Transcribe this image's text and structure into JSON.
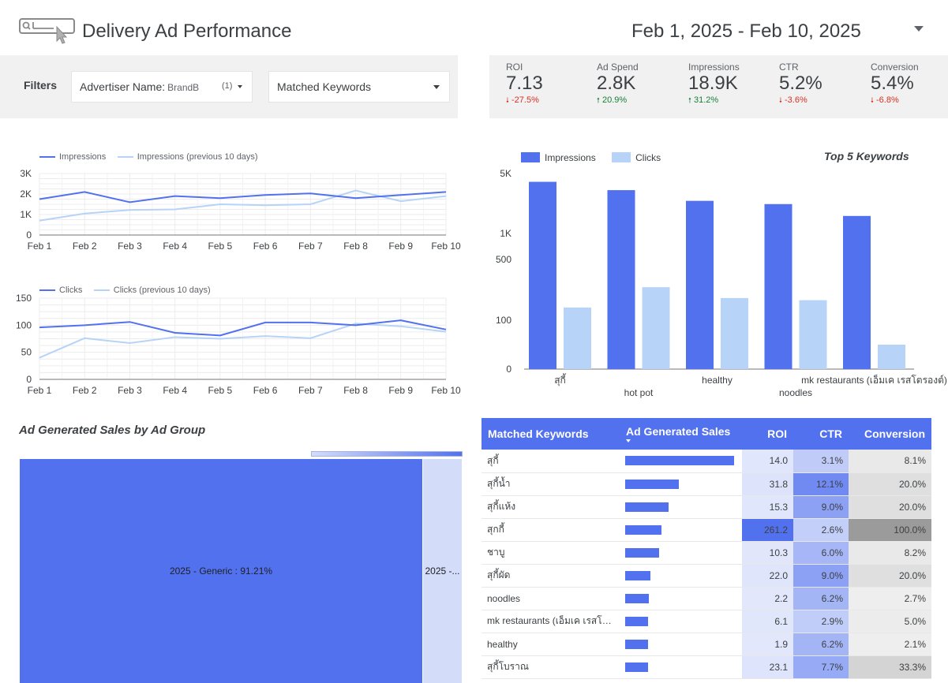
{
  "header": {
    "title": "Delivery Ad Performance",
    "date_range": "Feb 1, 2025 - Feb 10, 2025"
  },
  "filters": {
    "label": "Filters",
    "advertiser": {
      "name": "Advertiser Name:",
      "value": "BrandB",
      "count": "(1)"
    },
    "keywords": {
      "name": "Matched Keywords"
    }
  },
  "kpis": [
    {
      "label": "ROI",
      "value": "7.13",
      "delta": "-27.5%",
      "direction": "down"
    },
    {
      "label": "Ad Spend",
      "value": "2.8K",
      "delta": "20.9%",
      "direction": "up"
    },
    {
      "label": "Impressions",
      "value": "18.9K",
      "delta": "31.2%",
      "direction": "up"
    },
    {
      "label": "CTR",
      "value": "5.2%",
      "delta": "-3.6%",
      "direction": "down"
    },
    {
      "label": "Conversion",
      "value": "5.4%",
      "delta": "-6.8%",
      "direction": "down"
    }
  ],
  "colors": {
    "primary": "#5271ef",
    "secondary": "#b7d3f7",
    "up": "#188038",
    "down": "#d93025"
  },
  "chart_data": [
    {
      "type": "line",
      "categories": [
        "Feb 1",
        "Feb 2",
        "Feb 3",
        "Feb 4",
        "Feb 5",
        "Feb 6",
        "Feb 7",
        "Feb 8",
        "Feb 9",
        "Feb 10"
      ],
      "series": [
        {
          "name": "Impressions",
          "values": [
            1750,
            2100,
            1600,
            1900,
            1800,
            1950,
            2030,
            1800,
            1950,
            2100
          ]
        },
        {
          "name": "Impressions (previous 10 days)",
          "values": [
            700,
            1050,
            1220,
            1250,
            1500,
            1450,
            1500,
            2170,
            1650,
            1900
          ]
        }
      ],
      "yticks": [
        "0",
        "1K",
        "2K",
        "3K"
      ],
      "ylim": [
        0,
        3000
      ]
    },
    {
      "type": "line",
      "categories": [
        "Feb 1",
        "Feb 2",
        "Feb 3",
        "Feb 4",
        "Feb 5",
        "Feb 6",
        "Feb 7",
        "Feb 8",
        "Feb 9",
        "Feb 10"
      ],
      "series": [
        {
          "name": "Clicks",
          "values": [
            96,
            100,
            106,
            86,
            81,
            105,
            105,
            100,
            109,
            92
          ]
        },
        {
          "name": "Clicks (previous 10 days)",
          "values": [
            40,
            76,
            67,
            78,
            75,
            80,
            76,
            103,
            98,
            88
          ]
        }
      ],
      "yticks": [
        "0",
        "50",
        "100",
        "150"
      ],
      "ylim": [
        0,
        150
      ]
    },
    {
      "type": "bar",
      "title": "Top 5 Keywords",
      "categories": [
        "สุกี้",
        "hot pot",
        "healthy",
        "noodles",
        "mk restaurants (เอ็มเค เรสโตรองต์)"
      ],
      "series": [
        {
          "name": "Impressions",
          "values": [
            4000,
            3200,
            2400,
            2200,
            1600
          ]
        },
        {
          "name": "Clicks",
          "values": [
            140,
            240,
            180,
            170,
            50
          ]
        }
      ],
      "yticks": [
        "0",
        "100",
        "500",
        "1K",
        "5K"
      ],
      "yscale": "log",
      "grid": false,
      "legend": "top-left"
    },
    {
      "type": "treemap",
      "title": "Ad Generated Sales by Ad Group",
      "items": [
        {
          "label": "2025 - Generic : 91.21%",
          "share": 91.21
        },
        {
          "label": "2025 -...",
          "share": 8.79
        }
      ]
    },
    {
      "type": "table",
      "columns": [
        "Matched Keywords",
        "Ad Generated Sales",
        "ROI",
        "CTR",
        "Conversion"
      ],
      "rows": [
        {
          "keyword": "สุกี้",
          "sales": 1.0,
          "roi": "14.0",
          "roi_v": 14.0,
          "ctr": "3.1%",
          "ctr_v": 3.1,
          "conv": "8.1%",
          "conv_v": 8.1
        },
        {
          "keyword": "สุกี้น้ำ",
          "sales": 0.49,
          "roi": "31.8",
          "roi_v": 31.8,
          "ctr": "12.1%",
          "ctr_v": 12.1,
          "conv": "20.0%",
          "conv_v": 20.0
        },
        {
          "keyword": "สุกี้แห้ง",
          "sales": 0.4,
          "roi": "15.3",
          "roi_v": 15.3,
          "ctr": "9.0%",
          "ctr_v": 9.0,
          "conv": "20.0%",
          "conv_v": 20.0
        },
        {
          "keyword": "สุกกี้",
          "sales": 0.33,
          "roi": "261.2",
          "roi_v": 261.2,
          "ctr": "2.6%",
          "ctr_v": 2.6,
          "conv": "100.0%",
          "conv_v": 100.0
        },
        {
          "keyword": "ชาบู",
          "sales": 0.31,
          "roi": "10.3",
          "roi_v": 10.3,
          "ctr": "6.0%",
          "ctr_v": 6.0,
          "conv": "8.2%",
          "conv_v": 8.2
        },
        {
          "keyword": "สุกี้ผัด",
          "sales": 0.23,
          "roi": "22.0",
          "roi_v": 22.0,
          "ctr": "9.0%",
          "ctr_v": 9.0,
          "conv": "20.0%",
          "conv_v": 20.0
        },
        {
          "keyword": "noodles",
          "sales": 0.22,
          "roi": "2.2",
          "roi_v": 2.2,
          "ctr": "6.2%",
          "ctr_v": 6.2,
          "conv": "2.7%",
          "conv_v": 2.7
        },
        {
          "keyword": "mk restaurants (เอ็มเค เรสโตรองต์)",
          "sales": 0.21,
          "roi": "6.1",
          "roi_v": 6.1,
          "ctr": "2.9%",
          "ctr_v": 2.9,
          "conv": "5.0%",
          "conv_v": 5.0
        },
        {
          "keyword": "healthy",
          "sales": 0.21,
          "roi": "1.9",
          "roi_v": 1.9,
          "ctr": "6.2%",
          "ctr_v": 6.2,
          "conv": "2.1%",
          "conv_v": 2.1
        },
        {
          "keyword": "สุกี้โบราณ",
          "sales": 0.21,
          "roi": "23.1",
          "roi_v": 23.1,
          "ctr": "7.7%",
          "ctr_v": 7.7,
          "conv": "33.3%",
          "conv_v": 33.3
        }
      ]
    }
  ]
}
